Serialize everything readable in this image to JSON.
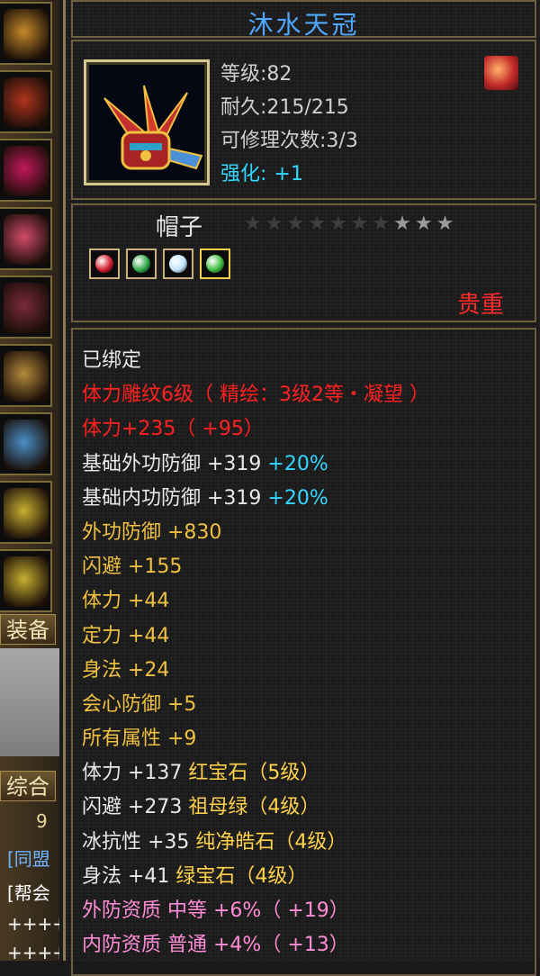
{
  "left_strip": {
    "slots": [
      {
        "icon": "hat-icon",
        "color": "#c58a2a"
      },
      {
        "icon": "bracer-icon",
        "color": "#b0341e"
      },
      {
        "icon": "glove-icon",
        "color": "#c2185b"
      },
      {
        "icon": "belt-icon",
        "color": "#d14b6a"
      },
      {
        "icon": "boot-icon",
        "color": "#7a2a3a"
      },
      {
        "icon": "ring-icon",
        "color": "#b48a3c"
      },
      {
        "icon": "ring-icon",
        "color": "#4a90c8"
      },
      {
        "icon": "amulet-icon",
        "color": "#c8b030"
      },
      {
        "icon": "amulet-icon",
        "color": "#c8b030"
      }
    ],
    "equip_label": "装备",
    "combine_label": "综合",
    "chat": [
      "9",
      "[同盟",
      "[帮会",
      "++++",
      "++++"
    ]
  },
  "item": {
    "name": "沐水天冠",
    "level": "等级:82",
    "durability": "耐久:215/215",
    "repair": "可修理次数:3/3",
    "enhance_label": "强化:",
    "enhance_value": "+1",
    "type": "帽子",
    "stars": {
      "total": 10,
      "lit": 3
    },
    "gems": [
      "#d21f2f",
      "#2fa84a",
      "#bfe3ff",
      "#3fbf3f"
    ],
    "rarity": "贵重",
    "colors": {
      "title": "#4fa8ff",
      "rarity": "#ff2a2a"
    }
  },
  "stats": [
    [
      {
        "t": "已绑定",
        "c": "white"
      }
    ],
    [
      {
        "t": "体力雕纹6级（ 精绘：3级2等・凝望 ）",
        "c": "red"
      }
    ],
    [
      {
        "t": "体力+235（ +95）",
        "c": "red"
      }
    ],
    [
      {
        "t": "基础外功防御 +319 ",
        "c": "white"
      },
      {
        "t": "+20%",
        "c": "cyan"
      }
    ],
    [
      {
        "t": "基础内功防御 +319 ",
        "c": "white"
      },
      {
        "t": "+20%",
        "c": "cyan"
      }
    ],
    [
      {
        "t": "外功防御 +830",
        "c": "yellow"
      }
    ],
    [
      {
        "t": "闪避 +155",
        "c": "yellow"
      }
    ],
    [
      {
        "t": "体力 +44",
        "c": "yellow"
      }
    ],
    [
      {
        "t": "定力 +44",
        "c": "yellow"
      }
    ],
    [
      {
        "t": "身法 +24",
        "c": "yellow"
      }
    ],
    [
      {
        "t": "会心防御 +5",
        "c": "yellow"
      }
    ],
    [
      {
        "t": "所有属性 +9",
        "c": "yellow"
      }
    ],
    [
      {
        "t": "体力 +137 ",
        "c": "white"
      },
      {
        "t": "红宝石（5级）",
        "c": "gold"
      }
    ],
    [
      {
        "t": "闪避 +273 ",
        "c": "white"
      },
      {
        "t": "祖母绿（4级）",
        "c": "gold"
      }
    ],
    [
      {
        "t": "冰抗性 +35 ",
        "c": "white"
      },
      {
        "t": "纯净皓石（4级）",
        "c": "gold"
      }
    ],
    [
      {
        "t": "身法 +41 ",
        "c": "white"
      },
      {
        "t": "绿宝石（4级）",
        "c": "gold"
      }
    ],
    [
      {
        "t": "外防资质  中等 +6%（ +19）",
        "c": "pink"
      }
    ],
    [
      {
        "t": "内防资质  普通 +4%（ +13）",
        "c": "pink"
      }
    ]
  ]
}
